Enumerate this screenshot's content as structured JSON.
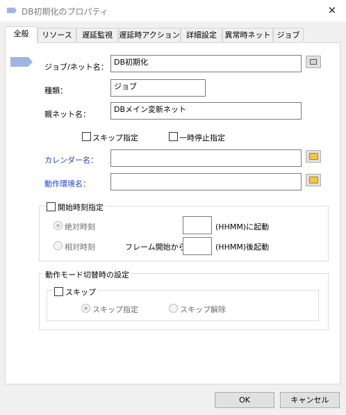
{
  "window": {
    "title": "DB初期化のプロパティ",
    "close_glyph": "✕"
  },
  "tabs": [
    {
      "label": "全般"
    },
    {
      "label": "リソース"
    },
    {
      "label": "遅延監視"
    },
    {
      "label": "遅延時アクション"
    },
    {
      "label": "詳細設定"
    },
    {
      "label": "異常時ネット"
    },
    {
      "label": "ジョブ"
    }
  ],
  "general": {
    "job_net_name_label": "ジョブ/ネット名：",
    "job_net_name_value": "DB初期化",
    "type_label": "種類：",
    "type_value": "ジョブ",
    "parent_net_label": "親ネット名：",
    "parent_net_value": "DBメイン変新ネット",
    "skip_flag_label": "スキップ指定",
    "pause_flag_label": "一時停止指定",
    "calendar_label": "カレンダー名：",
    "calendar_value": "",
    "environment_label": "動作環境名：",
    "environment_value": ""
  },
  "start_time": {
    "group_label": "開始時刻指定",
    "absolute_label": "絶対時刻",
    "absolute_suffix": "(HHMM)に起動",
    "relative_label": "相対時刻",
    "relative_prefix": "フレーム開始から",
    "relative_suffix": "(HHMM)後起動",
    "absolute_value": "",
    "relative_value": ""
  },
  "mode_switch": {
    "group_label": "動作モード切替時の設定",
    "skip_label": "スキップ",
    "skip_on_label": "スキップ指定",
    "skip_off_label": "スキップ解除"
  },
  "buttons": {
    "ok": "OK",
    "cancel": "キャンセル"
  },
  "colors": {
    "link": "#1c3fd1",
    "job_icon": "#9fb6e0"
  }
}
